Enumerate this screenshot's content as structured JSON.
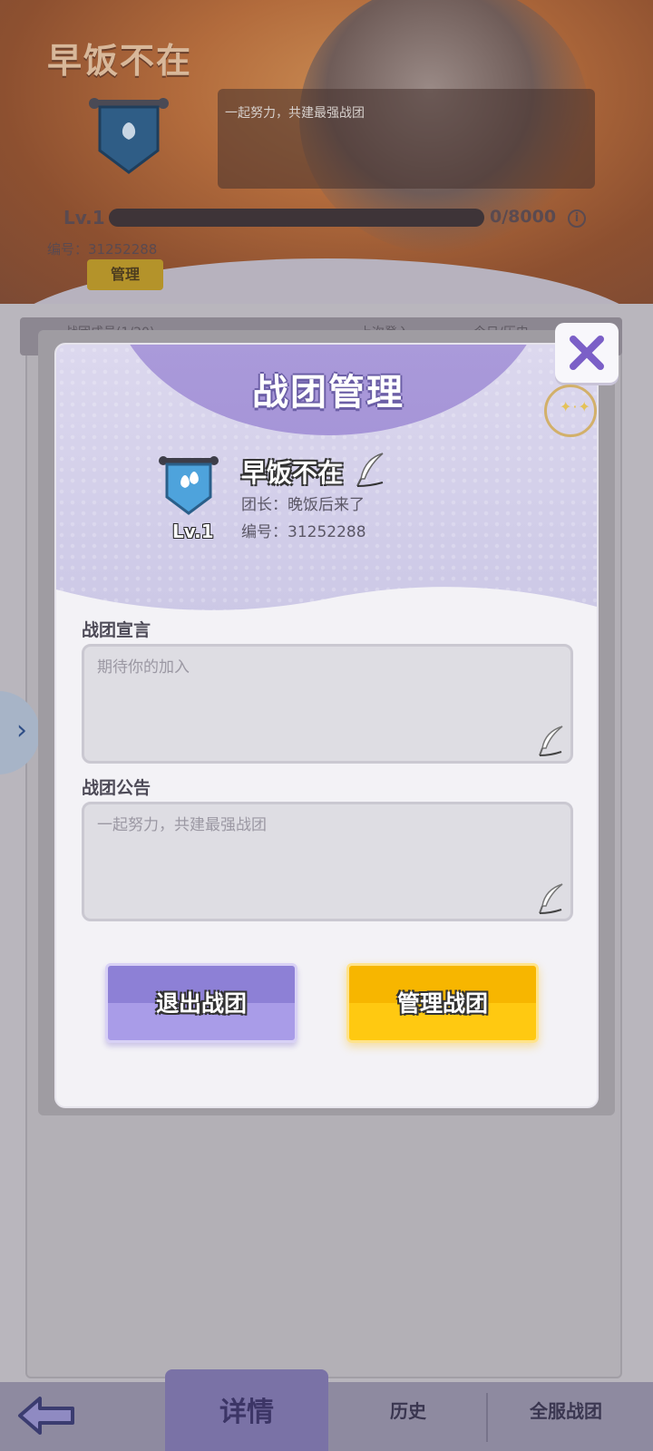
{
  "background": {
    "guild_title": "早饭不在",
    "notice_text": "一起努力，共建最强战团",
    "level": "Lv.1",
    "exp_text": "0/8000",
    "exp_progress": 0,
    "number_text": "编号：31252288",
    "manage_label": "管理",
    "list_header": [
      "战团成员(1/20)",
      "上次登入",
      "今日/历史"
    ]
  },
  "modal": {
    "title": "战团管理",
    "guild_name": "早饭不在",
    "level": "Lv.1",
    "leader": "团长：晚饭后来了",
    "number": "编号：31252288",
    "declaration_label": "战团宣言",
    "declaration_text": "期待你的加入",
    "announcement_label": "战团公告",
    "announcement_text": "一起努力，共建最强战团",
    "exit_button": "退出战团",
    "manage_button": "管理战团"
  },
  "bottom_nav": {
    "tab_details": "详情",
    "tab_history": "历史",
    "tab_server": "全服战团"
  },
  "colors": {
    "accent_purple": "#a695d8",
    "button_purple": "#8d80d6",
    "button_yellow": "#f7b600",
    "close_icon": "#7b5fc7"
  },
  "icons": [
    "close-icon",
    "more-icon",
    "guild-shield-icon",
    "edit-feather-icon",
    "back-arrow-icon",
    "side-expand-arrow-icon"
  ]
}
